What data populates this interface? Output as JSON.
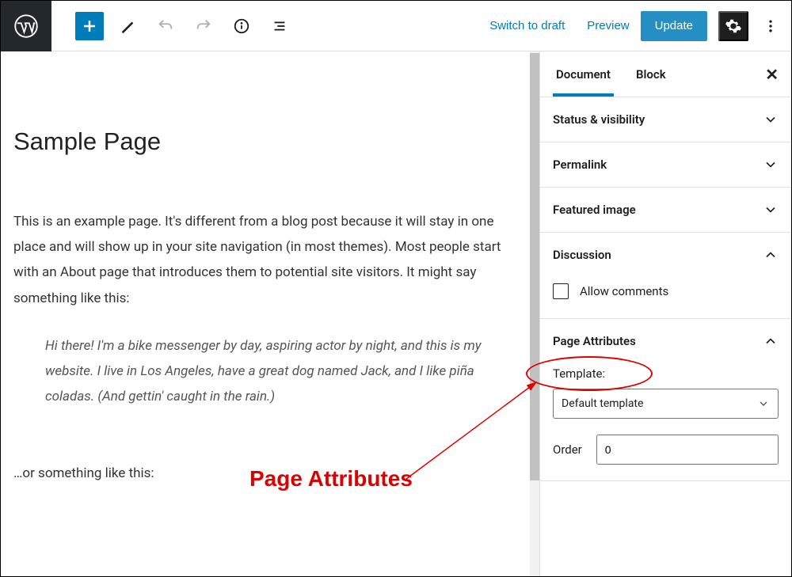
{
  "topbar": {
    "switch_draft": "Switch to draft",
    "preview": "Preview",
    "update": "Update"
  },
  "editor": {
    "title": "Sample Page",
    "para1": "This is an example page. It's different from a blog post because it will stay in one place and will show up in your site navigation (in most themes). Most people start with an About page that introduces them to potential site visitors. It might say something like this:",
    "quote": "Hi there! I'm a bike messenger by day, aspiring actor by night, and this is my website. I live in Los Angeles, have a great dog named Jack, and I like piña coladas. (And gettin' caught in the rain.)",
    "para2": "…or something like this:"
  },
  "sidebar": {
    "tabs": {
      "document": "Document",
      "block": "Block"
    },
    "panels": {
      "status": "Status & visibility",
      "permalink": "Permalink",
      "featured": "Featured image",
      "discussion": "Discussion",
      "allow_comments": "Allow comments",
      "page_attrs": "Page Attributes",
      "template_label": "Template:",
      "template_value": "Default template",
      "order_label": "Order",
      "order_value": "0"
    }
  },
  "annotation": {
    "label": "Page Attributes"
  }
}
